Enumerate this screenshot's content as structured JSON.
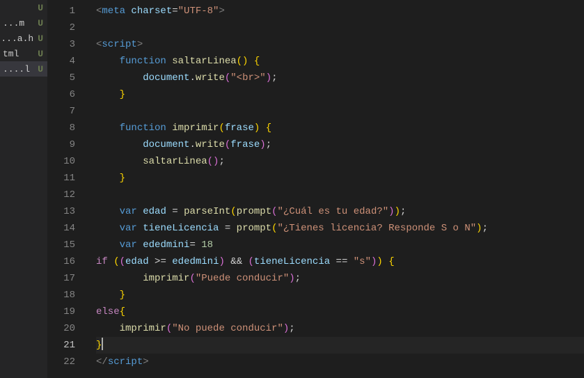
{
  "sidebar": {
    "items": [
      {
        "name": "",
        "badge": "U",
        "selected": false
      },
      {
        "name": "m...",
        "badge": "U",
        "selected": false
      },
      {
        "name": "a.h...",
        "badge": "U",
        "selected": false
      },
      {
        "name": "tml",
        "badge": "U",
        "selected": false
      },
      {
        "name": "l....",
        "badge": "U",
        "selected": true
      }
    ]
  },
  "editor": {
    "currentLine": 21,
    "lines": [
      {
        "n": 1,
        "html": "<span class='tk-punc'>&lt;</span><span class='tk-tag'>meta</span> <span class='tk-attr'>charset</span><span class='tk-plain'>=</span><span class='tk-str'>\"UTF-8\"</span><span class='tk-punc'>&gt;</span>"
      },
      {
        "n": 2,
        "html": ""
      },
      {
        "n": 3,
        "html": "<span class='tk-punc'>&lt;</span><span class='tk-tag'>script</span><span class='tk-punc'>&gt;</span>"
      },
      {
        "n": 4,
        "html": "    <span class='tk-kw'>function</span> <span class='tk-fn'>saltarLinea</span><span class='tk-brace'>()</span> <span class='tk-brace'>{</span>"
      },
      {
        "n": 5,
        "html": "        <span class='tk-ident'>document</span><span class='tk-plain'>.</span><span class='tk-fn'>write</span><span class='tk-brace2'>(</span><span class='tk-str'>\"&lt;br&gt;\"</span><span class='tk-brace2'>)</span><span class='tk-plain'>;</span>"
      },
      {
        "n": 6,
        "html": "    <span class='tk-brace'>}</span>"
      },
      {
        "n": 7,
        "html": ""
      },
      {
        "n": 8,
        "html": "    <span class='tk-kw'>function</span> <span class='tk-fn'>imprimir</span><span class='tk-brace'>(</span><span class='tk-ident'>frase</span><span class='tk-brace'>)</span> <span class='tk-brace'>{</span>"
      },
      {
        "n": 9,
        "html": "        <span class='tk-ident'>document</span><span class='tk-plain'>.</span><span class='tk-fn'>write</span><span class='tk-brace2'>(</span><span class='tk-ident'>frase</span><span class='tk-brace2'>)</span><span class='tk-plain'>;</span>"
      },
      {
        "n": 10,
        "html": "        <span class='tk-fn'>saltarLinea</span><span class='tk-brace2'>()</span><span class='tk-plain'>;</span>"
      },
      {
        "n": 11,
        "html": "    <span class='tk-brace'>}</span>"
      },
      {
        "n": 12,
        "html": ""
      },
      {
        "n": 13,
        "html": "    <span class='tk-kw'>var</span> <span class='tk-ident'>edad</span> <span class='tk-plain'>=</span> <span class='tk-fn'>parseInt</span><span class='tk-brace'>(</span><span class='tk-fn'>prompt</span><span class='tk-brace2'>(</span><span class='tk-str'>\"¿Cuál es tu edad?\"</span><span class='tk-brace2'>)</span><span class='tk-brace'>)</span><span class='tk-plain'>;</span>"
      },
      {
        "n": 14,
        "html": "    <span class='tk-kw'>var</span> <span class='tk-ident'>tieneLicencia</span> <span class='tk-plain'>=</span> <span class='tk-fn'>prompt</span><span class='tk-brace'>(</span><span class='tk-str'>\"¿Tienes licencia? Responde S o N\"</span><span class='tk-brace'>)</span><span class='tk-plain'>;</span>"
      },
      {
        "n": 15,
        "html": "    <span class='tk-kw'>var</span> <span class='tk-ident'>ededmini</span><span class='tk-plain'>=</span> <span class='tk-num'>18</span>"
      },
      {
        "n": 16,
        "html": "<span class='tk-kwf'>if</span> <span class='tk-brace'>(</span><span class='tk-brace2'>(</span><span class='tk-ident'>edad</span> <span class='tk-plain'>&gt;=</span> <span class='tk-ident'>ededmini</span><span class='tk-brace2'>)</span> <span class='tk-plain'>&amp;&amp;</span> <span class='tk-brace2'>(</span><span class='tk-ident'>tieneLicencia</span> <span class='tk-plain'>==</span> <span class='tk-str'>\"s\"</span><span class='tk-brace2'>)</span><span class='tk-brace'>)</span> <span class='tk-brace'>{</span>"
      },
      {
        "n": 17,
        "html": "        <span class='tk-fn'>imprimir</span><span class='tk-brace2'>(</span><span class='tk-str'>\"Puede conducir\"</span><span class='tk-brace2'>)</span><span class='tk-plain'>;</span>"
      },
      {
        "n": 18,
        "html": "    <span class='tk-brace'>}</span>"
      },
      {
        "n": 19,
        "html": "<span class='tk-kwf'>else</span><span class='tk-brace'>{</span>"
      },
      {
        "n": 20,
        "html": "    <span class='tk-fn'>imprimir</span><span class='tk-brace2'>(</span><span class='tk-str'>\"No puede conducir\"</span><span class='tk-brace2'>)</span><span class='tk-plain'>;</span>"
      },
      {
        "n": 21,
        "html": "<span class='tk-brace'>}</span><span class='caret'></span>"
      },
      {
        "n": 22,
        "html": "<span class='tk-punc'>&lt;/</span><span class='tk-tag'>script</span><span class='tk-punc'>&gt;</span>"
      }
    ]
  }
}
